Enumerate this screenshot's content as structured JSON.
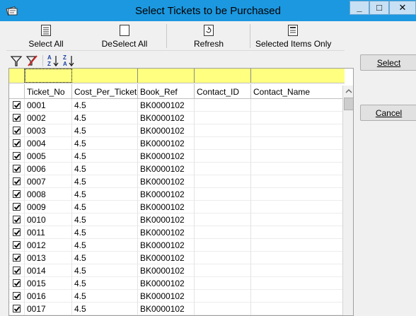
{
  "window": {
    "title": "Select Tickets to be Purchased",
    "minimize_glyph": "_",
    "maximize_glyph": "□",
    "close_glyph": "✕"
  },
  "toolbar": {
    "select_all": "Select All",
    "deselect_all": "DeSelect All",
    "refresh": "Refresh",
    "selected_only": "Selected Items Only"
  },
  "side_buttons": {
    "select": "Select",
    "cancel": "Cancel"
  },
  "grid": {
    "columns": [
      "Ticket_No",
      "Cost_Per_Ticket",
      "Book_Ref",
      "Contact_ID",
      "Contact_Name"
    ],
    "rows": [
      {
        "checked": true,
        "ticket_no": "0001",
        "cost": "4.5",
        "book_ref": "BK0000102",
        "contact_id": "",
        "contact_name": ""
      },
      {
        "checked": true,
        "ticket_no": "0002",
        "cost": "4.5",
        "book_ref": "BK0000102",
        "contact_id": "",
        "contact_name": ""
      },
      {
        "checked": true,
        "ticket_no": "0003",
        "cost": "4.5",
        "book_ref": "BK0000102",
        "contact_id": "",
        "contact_name": ""
      },
      {
        "checked": true,
        "ticket_no": "0004",
        "cost": "4.5",
        "book_ref": "BK0000102",
        "contact_id": "",
        "contact_name": ""
      },
      {
        "checked": true,
        "ticket_no": "0005",
        "cost": "4.5",
        "book_ref": "BK0000102",
        "contact_id": "",
        "contact_name": ""
      },
      {
        "checked": true,
        "ticket_no": "0006",
        "cost": "4.5",
        "book_ref": "BK0000102",
        "contact_id": "",
        "contact_name": ""
      },
      {
        "checked": true,
        "ticket_no": "0007",
        "cost": "4.5",
        "book_ref": "BK0000102",
        "contact_id": "",
        "contact_name": ""
      },
      {
        "checked": true,
        "ticket_no": "0008",
        "cost": "4.5",
        "book_ref": "BK0000102",
        "contact_id": "",
        "contact_name": ""
      },
      {
        "checked": true,
        "ticket_no": "0009",
        "cost": "4.5",
        "book_ref": "BK0000102",
        "contact_id": "",
        "contact_name": ""
      },
      {
        "checked": true,
        "ticket_no": "0010",
        "cost": "4.5",
        "book_ref": "BK0000102",
        "contact_id": "",
        "contact_name": ""
      },
      {
        "checked": true,
        "ticket_no": "0011",
        "cost": "4.5",
        "book_ref": "BK0000102",
        "contact_id": "",
        "contact_name": ""
      },
      {
        "checked": true,
        "ticket_no": "0012",
        "cost": "4.5",
        "book_ref": "BK0000102",
        "contact_id": "",
        "contact_name": ""
      },
      {
        "checked": true,
        "ticket_no": "0013",
        "cost": "4.5",
        "book_ref": "BK0000102",
        "contact_id": "",
        "contact_name": ""
      },
      {
        "checked": true,
        "ticket_no": "0014",
        "cost": "4.5",
        "book_ref": "BK0000102",
        "contact_id": "",
        "contact_name": ""
      },
      {
        "checked": true,
        "ticket_no": "0015",
        "cost": "4.5",
        "book_ref": "BK0000102",
        "contact_id": "",
        "contact_name": ""
      },
      {
        "checked": true,
        "ticket_no": "0016",
        "cost": "4.5",
        "book_ref": "BK0000102",
        "contact_id": "",
        "contact_name": ""
      },
      {
        "checked": true,
        "ticket_no": "0017",
        "cost": "4.5",
        "book_ref": "BK0000102",
        "contact_id": "",
        "contact_name": ""
      }
    ]
  },
  "colors": {
    "titlebar": "#1c98e0",
    "filter_row": "#ffff80",
    "filter_icon_accent": "#d02020"
  },
  "icons": {
    "app": "tickets-app-icon",
    "filter": "filter-icon",
    "clear_filter": "clear-filter-icon",
    "sort_asc": "sort-ascending-icon",
    "sort_desc": "sort-descending-icon"
  }
}
